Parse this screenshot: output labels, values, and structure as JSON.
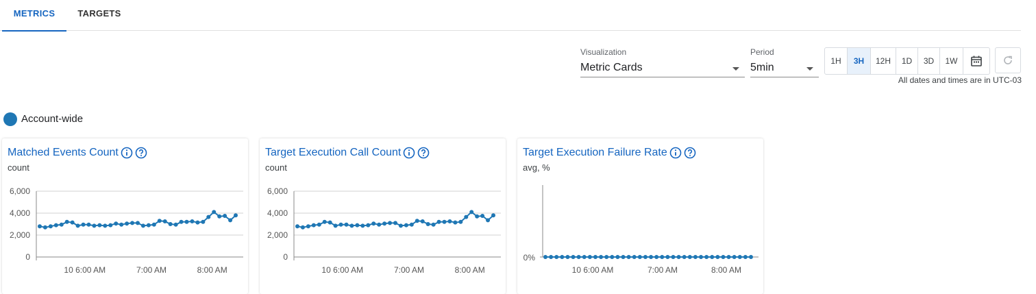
{
  "tabs": [
    {
      "label": "METRICS",
      "active": true
    },
    {
      "label": "TARGETS",
      "active": false
    }
  ],
  "controls": {
    "visualization": {
      "label": "Visualization",
      "value": "Metric Cards"
    },
    "period": {
      "label": "Period",
      "value": "5min"
    },
    "ranges": [
      {
        "label": "1H",
        "active": false
      },
      {
        "label": "3H",
        "active": true
      },
      {
        "label": "12H",
        "active": false
      },
      {
        "label": "1D",
        "active": false
      },
      {
        "label": "3D",
        "active": false
      },
      {
        "label": "1W",
        "active": false
      }
    ],
    "calendar_icon": "calendar-icon",
    "refresh_icon": "refresh-icon",
    "timezone_note": "All dates and times are in UTC-03"
  },
  "account": {
    "label": "Account-wide",
    "color": "#1f77b4"
  },
  "colors": {
    "accent": "#1565c0",
    "series": "#1f77b4"
  },
  "cards": [
    {
      "title": "Matched Events Count",
      "unit": "count"
    },
    {
      "title": "Target Execution Call Count",
      "unit": "count"
    },
    {
      "title": "Target Execution Failure Rate",
      "unit": "avg, %"
    }
  ],
  "chart_data": [
    {
      "type": "line",
      "title": "Matched Events Count",
      "ylabel": "count",
      "ylim": [
        0,
        6000
      ],
      "yticks": [
        "0",
        "2,000",
        "4,000",
        "6,000"
      ],
      "xticks": [
        "10 6:00 AM",
        "7:00 AM",
        "8:00 AM"
      ],
      "series": [
        {
          "values": [
            2800,
            2700,
            2800,
            2900,
            2950,
            3200,
            3150,
            2850,
            2950,
            2950,
            2850,
            2900,
            2850,
            2900,
            3050,
            2950,
            3050,
            3100,
            3100,
            2850,
            2900,
            2950,
            3300,
            3250,
            3000,
            2950,
            3200,
            3200,
            3250,
            3150,
            3200,
            3650,
            4100,
            3700,
            3750,
            3350,
            3800
          ]
        }
      ]
    },
    {
      "type": "line",
      "title": "Target Execution Call Count",
      "ylabel": "count",
      "ylim": [
        0,
        6000
      ],
      "yticks": [
        "0",
        "2,000",
        "4,000",
        "6,000"
      ],
      "xticks": [
        "10 6:00 AM",
        "7:00 AM",
        "8:00 AM"
      ],
      "series": [
        {
          "values": [
            2800,
            2700,
            2800,
            2900,
            2950,
            3200,
            3150,
            2850,
            2950,
            2950,
            2850,
            2900,
            2850,
            2900,
            3050,
            2950,
            3050,
            3100,
            3100,
            2850,
            2900,
            2950,
            3300,
            3250,
            3000,
            2950,
            3200,
            3200,
            3250,
            3150,
            3200,
            3650,
            4100,
            3700,
            3750,
            3350,
            3800
          ]
        }
      ]
    },
    {
      "type": "line",
      "title": "Target Execution Failure Rate",
      "ylabel": "avg, %",
      "yticks": [
        "0%"
      ],
      "xticks": [
        "10 6:00 AM",
        "7:00 AM",
        "8:00 AM"
      ],
      "series": [
        {
          "values": [
            0,
            0,
            0,
            0,
            0,
            0,
            0,
            0,
            0,
            0,
            0,
            0,
            0,
            0,
            0,
            0,
            0,
            0,
            0,
            0,
            0,
            0,
            0,
            0,
            0,
            0,
            0,
            0,
            0,
            0,
            0,
            0,
            0,
            0,
            0,
            0,
            0,
            0
          ]
        }
      ]
    }
  ]
}
